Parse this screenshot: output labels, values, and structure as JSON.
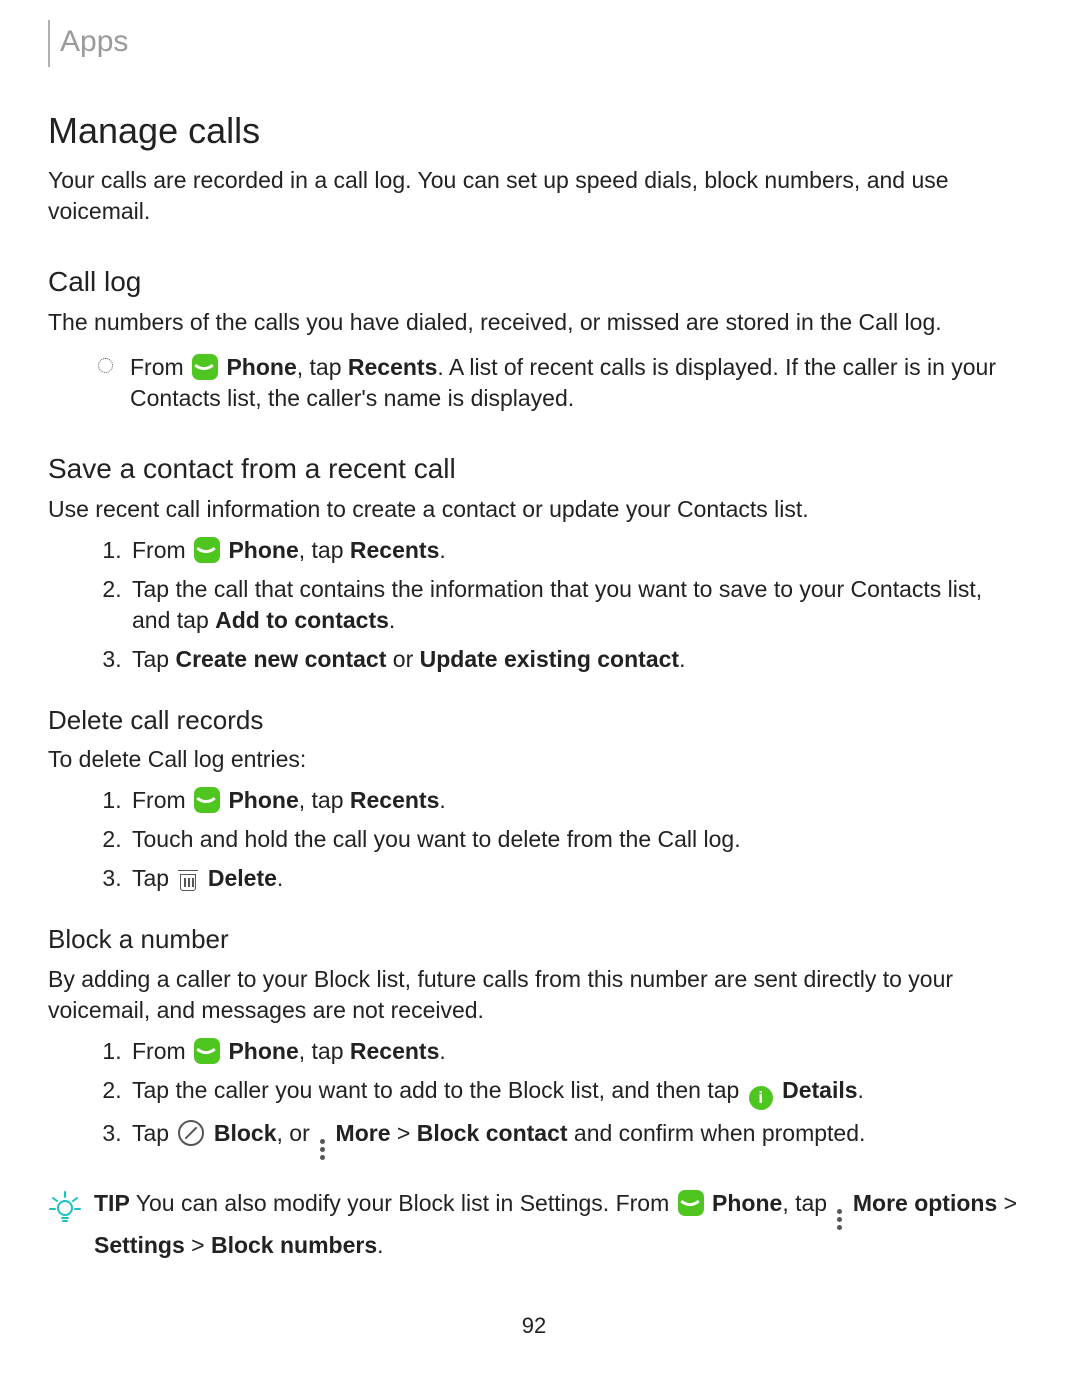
{
  "header": {
    "breadcrumb": "Apps"
  },
  "h1": "Manage calls",
  "intro": "Your calls are recorded in a call log. You can set up speed dials, block numbers, and use voicemail.",
  "callLog": {
    "title": "Call log",
    "desc": "The numbers of the calls you have dialed, received, or missed are stored in the Call log.",
    "bul_from": "From ",
    "bul_phone": "Phone",
    "bul_mid": ", tap ",
    "bul_recents": "Recents",
    "bul_tail": ". A list of recent calls is displayed. If the caller is in your Contacts list, the caller's name is displayed."
  },
  "save": {
    "title": "Save a contact from a recent call",
    "desc": "Use recent call information to create a contact or update your Contacts list.",
    "s1_from": "From ",
    "s1_phone": "Phone",
    "s1_mid": ", tap ",
    "s1_recents": "Recents",
    "s1_end": ".",
    "s2a": "Tap the call that contains the information that you want to save to your Contacts list, and tap ",
    "s2b": "Add to contacts",
    "s2c": ".",
    "s3a": "Tap ",
    "s3b": "Create new contact",
    "s3c": " or ",
    "s3d": "Update existing contact",
    "s3e": "."
  },
  "del": {
    "title": "Delete call records",
    "desc": "To delete Call log entries:",
    "s1_from": "From ",
    "s1_phone": "Phone",
    "s1_mid": ", tap ",
    "s1_recents": "Recents",
    "s1_end": ".",
    "s2": "Touch and hold the call you want to delete from the Call log.",
    "s3a": "Tap ",
    "s3b": "Delete",
    "s3c": "."
  },
  "block": {
    "title": "Block a number",
    "desc": "By adding a caller to your Block list, future calls from this number are sent directly to your voicemail, and messages are not received.",
    "s1_from": "From ",
    "s1_phone": "Phone",
    "s1_mid": ", tap ",
    "s1_recents": "Recents",
    "s1_end": ".",
    "s2a": "Tap the caller you want to add to the Block list, and then tap ",
    "s2b": "Details",
    "s2c": ".",
    "s3a": "Tap ",
    "s3b": "Block",
    "s3c": ", or ",
    "s3d": "More",
    "s3e": " > ",
    "s3f": "Block contact",
    "s3g": " and confirm when prompted."
  },
  "tip": {
    "label": "TIP",
    "a": "  You can also modify your Block list in Settings. From ",
    "phone": "Phone",
    "b": ", tap ",
    "more": "More options",
    "c": " > ",
    "settings": "Settings",
    "d": " > ",
    "blocknums": "Block numbers",
    "e": "."
  },
  "pageNum": "92"
}
